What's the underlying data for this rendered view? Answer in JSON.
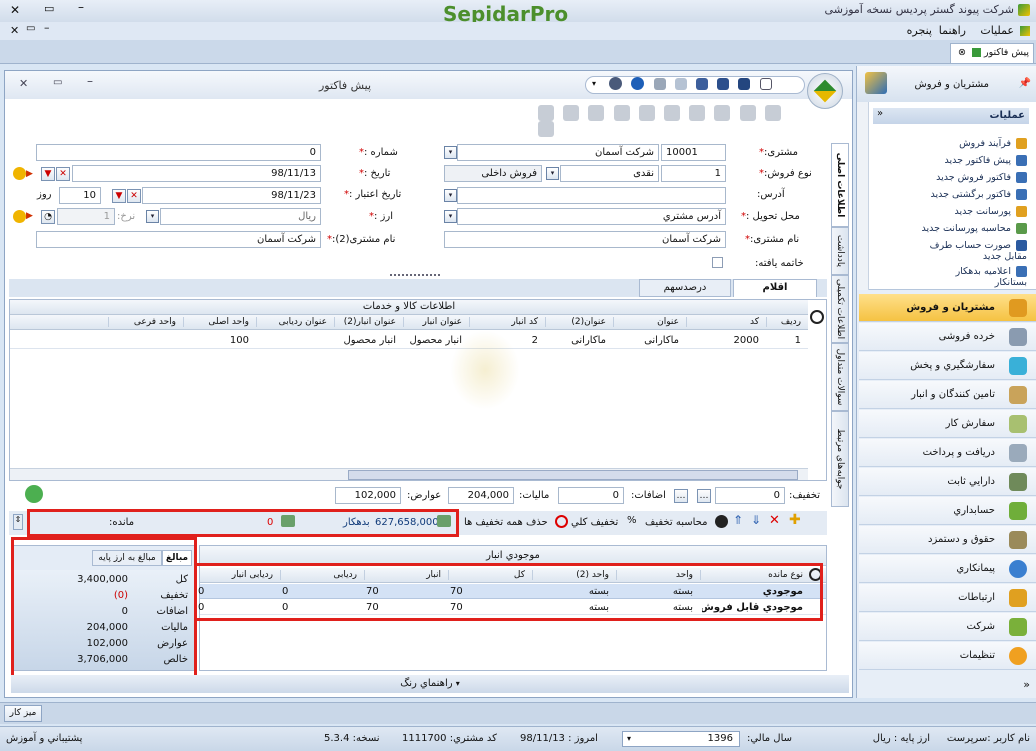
{
  "titlebar": {
    "app_title": "شرکت پیوند گستر پردیس نسخه آموزشی",
    "logo_text": "SepidarPro"
  },
  "menubar": {
    "items": [
      "عملیات",
      "راهنما",
      "پنجره"
    ]
  },
  "doc_tab": {
    "label": "پیش فاکتور"
  },
  "form": {
    "title": "پیش فاکتور",
    "customer_label": "مشتری:",
    "customer_code": "10001",
    "customer_name": "شرکت آسمان",
    "sale_type_label": "نوع فروش:",
    "sale_type_code": "1",
    "sale_type_name": "نقدی",
    "sale_scope": "فروش داخلی",
    "address_label": "آدرس:",
    "delivery_label": "محل تحویل :",
    "delivery_value": "آدرس مشتري",
    "customer_name_label": "نام مشتری:",
    "customer_name_value": "شرکت آسمان",
    "ended_label": "خاتمه یافته:",
    "number_label": "شماره :",
    "number_value": "0",
    "date_label": "تاریخ :",
    "date_value": "98/11/13",
    "validity_label": "تاریخ اعتبار :",
    "validity_value": "98/11/23",
    "days_value": "10",
    "days_unit": "روز",
    "currency_label": "ارز :",
    "currency_value": "ریال",
    "rate_label": "نرخ:",
    "rate_value": "1",
    "customer2_label": "نام مشتری(2):",
    "customer2_value": "شرکت آسمان"
  },
  "side_tabs": [
    "اطلاعات اصلی",
    "یادداشت",
    "اطلاعات تکمیلی",
    "سوالات متداول",
    "جوابه‌های مرتبط"
  ],
  "items_tabs": [
    "اقلام",
    "درصدسهم"
  ],
  "items_grid": {
    "group_header": "اطلاعات کالا و خدمات",
    "columns": [
      "رديف",
      "کد",
      "عنوان",
      "عنوان(2)",
      "کد انبار",
      "عنوان انبار",
      "عنوان انبار(2)",
      "عنوان ردیابی",
      "واحد اصلی",
      "واحد فرعی"
    ],
    "rows": [
      [
        "1",
        "2000",
        "ماکارانی",
        "ماکارانی",
        "2",
        "انبار محصول",
        "انبار محصول",
        "",
        "100",
        ""
      ]
    ]
  },
  "totals_bar": {
    "discount_label": "تخفیف:",
    "discount_value": "0",
    "additions_label": "اضافات:",
    "additions_value": "0",
    "tax_label": "مالیات:",
    "tax_value": "204,000",
    "duties_label": "عوارض:",
    "duties_value": "102,000"
  },
  "action_bar": {
    "calc_discount": "محاسبه تخفیف",
    "total_discount": "تخفیف کلي",
    "remove_discount": "حذف همه تخفیف ها",
    "balance_value": "627,658,000",
    "balance_suffix": "بدهکار",
    "remain_value": "0",
    "remain_label": "مانده:"
  },
  "stock_panel": {
    "title": "موجودي انبار",
    "columns": [
      "نوع مانده",
      "واحد",
      "واحد (2)",
      "کل",
      "انبار",
      "ردیابی",
      "ردیابی انبار"
    ],
    "rows": [
      [
        "موجودي",
        "بسته",
        "بسته",
        "70",
        "70",
        "0",
        "0"
      ],
      [
        "موجودي قابل فروش",
        "بسته",
        "بسته",
        "70",
        "70",
        "0",
        "0"
      ]
    ]
  },
  "amounts_panel": {
    "tabs": [
      "مبالغ",
      "مبالغ به ارز پایه"
    ],
    "rows": [
      {
        "label": "کل",
        "value": "3,400,000"
      },
      {
        "label": "تخفیف",
        "value": "(0)"
      },
      {
        "label": "اضافات",
        "value": "0"
      },
      {
        "label": "مالیات",
        "value": "204,000"
      },
      {
        "label": "عوارض",
        "value": "102,000"
      },
      {
        "label": "خالص",
        "value": "3,706,000"
      }
    ]
  },
  "color_guide": "راهنماي رنگ",
  "nav": {
    "header": "مشتریان و فروش",
    "ops_title": "عملیات",
    "ops": [
      "فرآیند فروش",
      "پیش فاکتور جدید",
      "فاکتور فروش جدید",
      "فاکتور برگشتی جدید",
      "پورسانت جدید",
      "محاسبه پورسانت جدید",
      "صورت حساب طرف مقابل جدید",
      "اعلامیه بدهکار بستانکار"
    ],
    "modules": [
      "مشتریان و فروش",
      "خرده فروشی",
      "سفارشگیري و پخش",
      "تامین کنندگان و انبار",
      "سفارش کار",
      "دریافت و پرداخت",
      "دارایي ثابت",
      "حسابداري",
      "حقوق و دستمزد",
      "پیمانکاري",
      "ارتباطات",
      "شرکت",
      "تنظیمات"
    ]
  },
  "taskbar": {
    "desktop": "میز کار"
  },
  "statusbar": {
    "user": "نام کاربر :سرپرست",
    "base_currency": "ارز پایه : ریال",
    "fiscal_year_label": "سال مالي:",
    "fiscal_year": "1396",
    "today": "امروز : 98/11/13",
    "customer_code": "کد مشتري: 1111700",
    "version": "نسخه: 5.3.4",
    "support": "پشتیباني و آموزش"
  },
  "colors": {
    "accent_red": "#e0201c",
    "nav_active": "#f5c242",
    "logo_green": "#4c8f2c"
  }
}
